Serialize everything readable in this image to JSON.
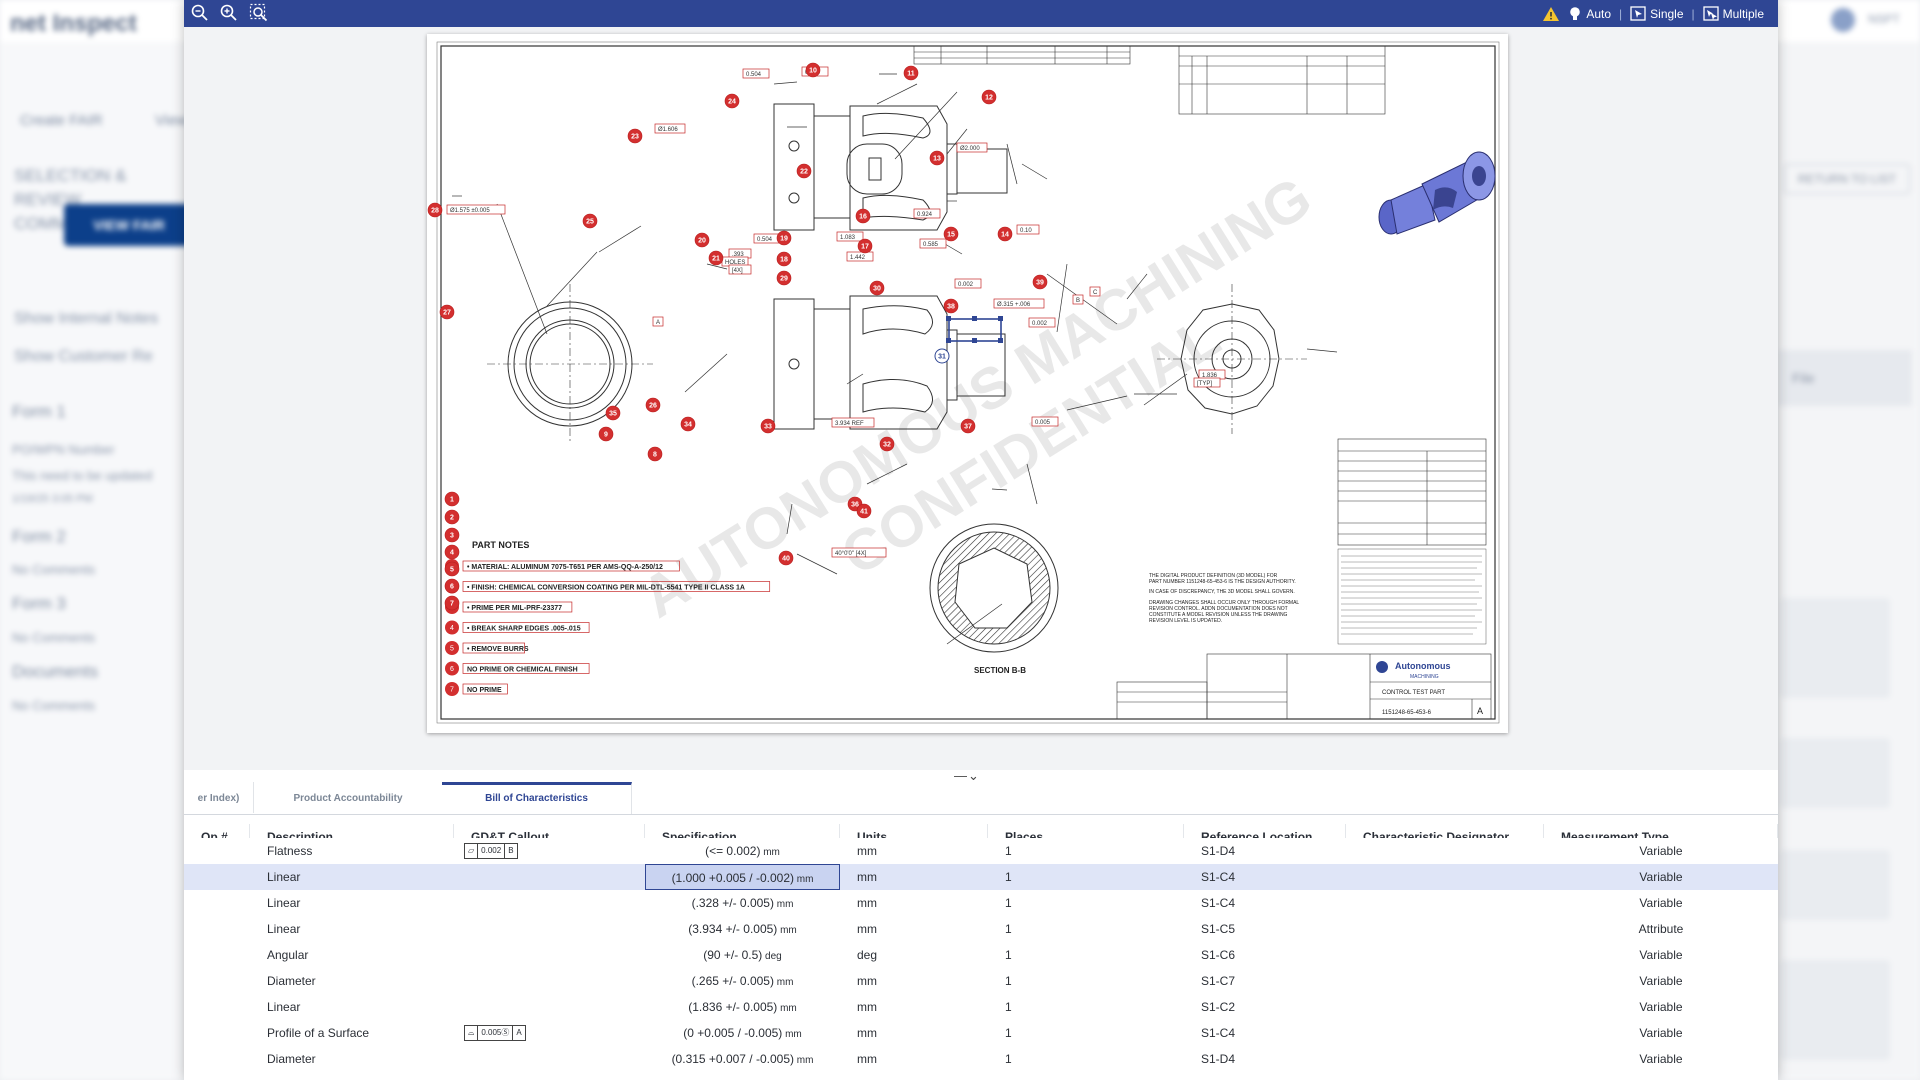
{
  "background": {
    "app_logo": "net Inspect",
    "user_label": "NSPT",
    "tabs": [
      "Create FAIR",
      "View"
    ],
    "section_title": "SELECTION & REVIEW COMMENTS",
    "view_button": "VIEW FAIR",
    "show_internal": "Show Internal Notes",
    "show_customer": "Show Customer Re",
    "left_items": [
      {
        "text": "Form 1",
        "kind": "head"
      },
      {
        "text": "PO/WPN Number",
        "kind": "sm"
      },
      {
        "text": "This need to be updated",
        "kind": "sm"
      },
      {
        "text": "1/19/25 3:05 PM",
        "kind": "xs"
      },
      {
        "text": "Form 2",
        "kind": "head"
      },
      {
        "text": "No Comments",
        "kind": "sm"
      },
      {
        "text": "Form 3",
        "kind": "head"
      },
      {
        "text": "No Comments",
        "kind": "sm"
      },
      {
        "text": "Documents",
        "kind": "head"
      },
      {
        "text": "No Comments",
        "kind": "sm"
      }
    ],
    "return_button": "RETURN TO LIST",
    "right_ghost": "File"
  },
  "toolbar": {
    "zoom_out_icon": "zoom-out-icon",
    "zoom_in_icon": "zoom-in-icon",
    "zoom_fit_icon": "zoom-fit-icon",
    "warning_icon": "warning-icon",
    "auto_label": "Auto",
    "single_label": "Single",
    "multiple_label": "Multiple"
  },
  "drawing": {
    "part_notes_title": "PART NOTES",
    "notes": [
      "MATERIAL: ALUMINUM 7075-T651 PER AMS-QQ-A-250/12",
      "FINISH: CHEMICAL CONVERSION COATING PER MIL-DTL-5541 TYPE II CLASS 1A",
      "PRIME PER MIL-PRF-23377",
      "BREAK SHARP EDGES .005-.015",
      "REMOVE BURRS",
      "NO PRIME OR CHEMICAL FINISH",
      "NO PRIME"
    ],
    "section_label": "SECTION B-B",
    "authority_text": [
      "THE DIGITAL PRODUCT DEFINITION (3D MODEL) FOR",
      "PART NUMBER 1151248-65-453-6 IS THE DESIGN AUTHORITY.",
      "IN CASE OF DISCREPANCY, THE 3D MODEL SHALL GOVERN.",
      "DRAWING CHANGES SHALL OCCUR ONLY THROUGH FORMAL",
      "REVISION CONTROL. ADDN DOCUMENTATION DOES NOT",
      "CONSTITUTE A MODEL REVISION UNLESS THE DRAWING",
      "REVISION LEVEL IS UPDATED."
    ],
    "company": "Autonomous",
    "company_sub": "MACHINING",
    "part_title": "CONTROL TEST PART",
    "part_number": "1151248-65-453-6",
    "rev": "A",
    "watermark_1": "AUTONOMOUS MACHINING",
    "watermark_2": "CONFIDENTIAL",
    "balloons": [
      "1",
      "2",
      "3",
      "4",
      "5",
      "6",
      "7",
      "8",
      "9",
      "10",
      "11",
      "12",
      "13",
      "14",
      "15",
      "16",
      "17",
      "18",
      "19",
      "20",
      "21",
      "22",
      "23",
      "24",
      "25",
      "26",
      "27",
      "28",
      "29",
      "30",
      "31",
      "32",
      "33",
      "34",
      "35",
      "36",
      "37",
      "38",
      "39",
      "40",
      "41"
    ],
    "dims": [
      "Ø1.575 ±0.005",
      "Ø1.606",
      "0.125",
      "0.504",
      "Ø2.000",
      "0.924",
      "1.083",
      "1.442",
      "0.504",
      "0.585",
      ".393",
      "HOLES",
      "[4X]",
      "0.002",
      "Ø.315 +.006",
      "0.10",
      "0.002",
      "3.934 REF",
      "0.005",
      "1.836",
      "40°0'0\" [4X]",
      "[TYP]",
      "A",
      "B",
      "C"
    ]
  },
  "tabs": {
    "items": [
      "er Index)",
      "Product Accountability",
      "Bill of Characteristics"
    ],
    "active": "Bill of Characteristics"
  },
  "grid": {
    "columns": [
      "Op #",
      "Description",
      "GD&T Callout",
      "Specification",
      "Units",
      "Places",
      "Reference Location",
      "Characteristic Designator",
      "Measurement Type"
    ],
    "rows": [
      {
        "op": "",
        "desc": "Flatness",
        "gdt": [
          "⏥",
          "0.002",
          "B"
        ],
        "spec": "(<= 0.002)",
        "unit_small": "mm",
        "units": "mm",
        "places": "1",
        "ref": "S1-D4",
        "char": "",
        "mtype": "Variable",
        "selected": false
      },
      {
        "op": "",
        "desc": "Linear",
        "gdt": [],
        "spec": "(1.000 +0.005 / -0.002)",
        "unit_small": "mm",
        "units": "mm",
        "places": "1",
        "ref": "S1-C4",
        "char": "",
        "mtype": "Variable",
        "selected": true
      },
      {
        "op": "",
        "desc": "Linear",
        "gdt": [],
        "spec": "(.328 +/- 0.005)",
        "unit_small": "mm",
        "units": "mm",
        "places": "1",
        "ref": "S1-C4",
        "char": "",
        "mtype": "Variable",
        "selected": false
      },
      {
        "op": "",
        "desc": "Linear",
        "gdt": [],
        "spec": "(3.934 +/- 0.005)",
        "unit_small": "mm",
        "units": "mm",
        "places": "1",
        "ref": "S1-C5",
        "char": "",
        "mtype": "Attribute",
        "selected": false
      },
      {
        "op": "",
        "desc": "Angular",
        "gdt": [],
        "spec": "(90 +/- 0.5)",
        "unit_small": "deg",
        "units": "deg",
        "places": "1",
        "ref": "S1-C6",
        "char": "",
        "mtype": "Variable",
        "selected": false
      },
      {
        "op": "",
        "desc": "Diameter",
        "gdt": [],
        "spec": "(.265 +/- 0.005)",
        "unit_small": "mm",
        "units": "mm",
        "places": "1",
        "ref": "S1-C7",
        "char": "",
        "mtype": "Variable",
        "selected": false
      },
      {
        "op": "",
        "desc": "Linear",
        "gdt": [],
        "spec": "(1.836 +/- 0.005)",
        "unit_small": "mm",
        "units": "mm",
        "places": "1",
        "ref": "S1-C2",
        "char": "",
        "mtype": "Variable",
        "selected": false
      },
      {
        "op": "",
        "desc": "Profile of a Surface",
        "gdt": [
          "⌓",
          "0.005Ⓢ",
          "A"
        ],
        "spec": "(0 +0.005 / -0.005)",
        "unit_small": "mm",
        "units": "mm",
        "places": "1",
        "ref": "S1-C4",
        "char": "",
        "mtype": "Variable",
        "selected": false
      },
      {
        "op": "",
        "desc": "Diameter",
        "gdt": [],
        "spec": "(0.315 +0.007 / -0.005)",
        "unit_small": "mm",
        "units": "mm",
        "places": "1",
        "ref": "S1-D4",
        "char": "",
        "mtype": "Variable",
        "selected": false
      }
    ]
  },
  "colors": {
    "toolbar": "#2f4694",
    "balloon": "#d32f2f",
    "selected_row": "#dfe5f7",
    "warning": "#f4c430"
  }
}
